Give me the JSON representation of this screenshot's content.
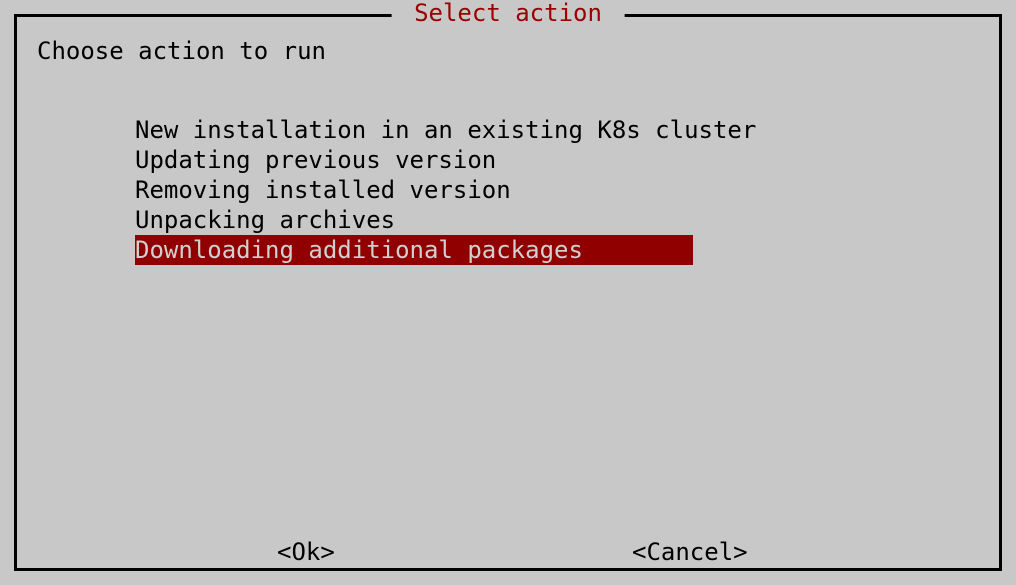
{
  "dialog": {
    "title": " Select action ",
    "prompt": "Choose action to run",
    "options": [
      {
        "label": "New installation in an existing K8s cluster",
        "selected": false
      },
      {
        "label": "Updating previous version",
        "selected": false
      },
      {
        "label": "Removing installed version",
        "selected": false
      },
      {
        "label": "Unpacking archives",
        "selected": false
      },
      {
        "label": "Downloading additional packages",
        "selected": true
      }
    ],
    "buttons": {
      "ok": "<Ok>",
      "cancel": "<Cancel>"
    }
  },
  "colors": {
    "background": "#c8c8c8",
    "title": "#9a0000",
    "selected_bg": "#910000",
    "selected_fg": "#d0d0d0",
    "text": "#000000",
    "border": "#000000"
  }
}
